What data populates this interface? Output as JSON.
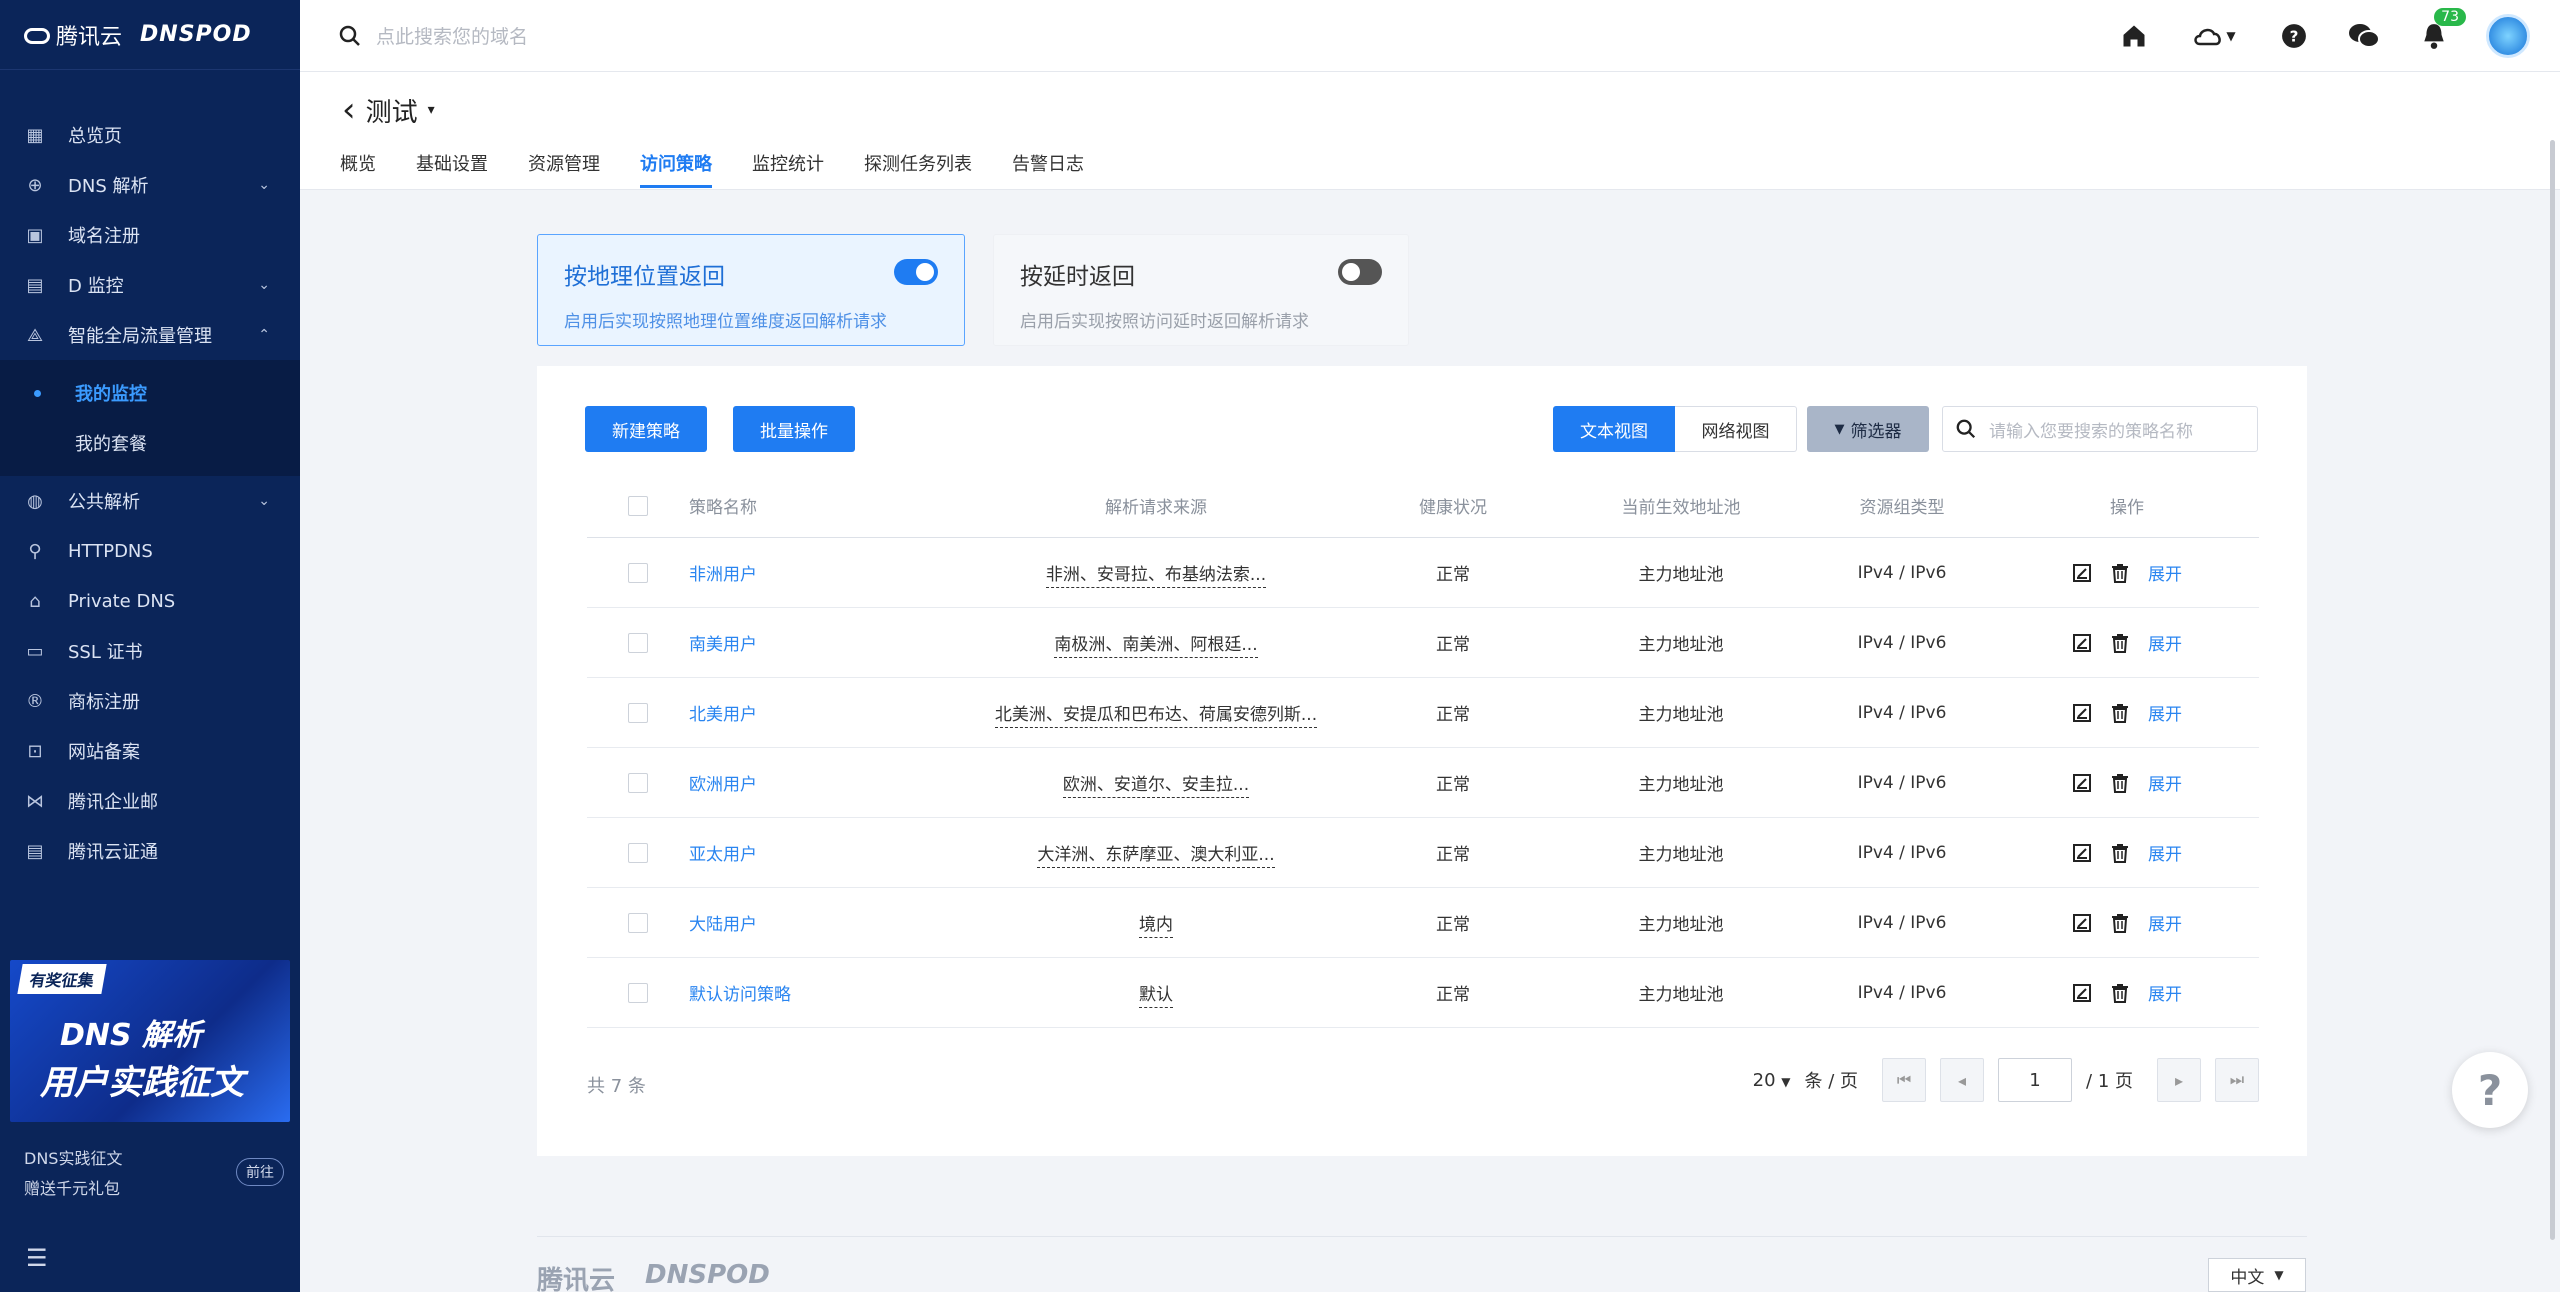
{
  "brand": {
    "name": "腾讯云",
    "product": "DNSPOD"
  },
  "sidebar": {
    "items": [
      {
        "label": "总览页",
        "icon": "grid-icon",
        "glyph": "▦"
      },
      {
        "label": "DNS 解析",
        "icon": "globe-icon",
        "glyph": "⊕",
        "chevron": "⌄"
      },
      {
        "label": "域名注册",
        "icon": "domain-icon",
        "glyph": "▣"
      },
      {
        "label": "D 监控",
        "icon": "monitor-icon",
        "glyph": "▤",
        "chevron": "⌄"
      },
      {
        "label": "智能全局流量管理",
        "icon": "traffic-icon",
        "glyph": "⟁",
        "chevron": "⌃"
      }
    ],
    "sub_items": [
      {
        "label": "我的监控",
        "active": true
      },
      {
        "label": "我的套餐",
        "active": false
      }
    ],
    "items2": [
      {
        "label": "公共解析",
        "icon": "public-dns-icon",
        "glyph": "◍",
        "chevron": "⌄"
      },
      {
        "label": "HTTPDNS",
        "icon": "httpdns-icon",
        "glyph": "⚲"
      },
      {
        "label": "Private DNS",
        "icon": "private-dns-icon",
        "glyph": "⌂"
      },
      {
        "label": "SSL 证书",
        "icon": "ssl-icon",
        "glyph": "▭"
      },
      {
        "label": "商标注册",
        "icon": "trademark-icon",
        "glyph": "®"
      },
      {
        "label": "网站备案",
        "icon": "filing-icon",
        "glyph": "⊡"
      },
      {
        "label": "腾讯企业邮",
        "icon": "mail-icon",
        "glyph": "⋈"
      },
      {
        "label": "腾讯云证通",
        "icon": "cert-icon",
        "glyph": "▤"
      }
    ],
    "promo": {
      "tag": "有奖征集",
      "line1": "DNS 解析",
      "line2": "用户实践征文",
      "text1": "DNS实践征文",
      "text2": "赠送千元礼包",
      "button": "前往"
    },
    "collapse_glyph": "☰"
  },
  "topbar": {
    "search_placeholder": "点此搜索您的域名",
    "notifications": "73"
  },
  "header": {
    "back_glyph": "‹",
    "title": "测试",
    "title_caret": "▾",
    "tabs": [
      "概览",
      "基础设置",
      "资源管理",
      "访问策略",
      "监控统计",
      "探测任务列表",
      "告警日志"
    ],
    "active_tab": 3
  },
  "modes": [
    {
      "title": "按地理位置返回",
      "desc": "启用后实现按照地理位置维度返回解析请求",
      "enabled": true
    },
    {
      "title": "按延时返回",
      "desc": "启用后实现按照访问延时返回解析请求",
      "enabled": false
    }
  ],
  "toolbar": {
    "new_label": "新建策略",
    "batch_label": "批量操作",
    "text_view": "文本视图",
    "network_view": "网络视图",
    "filter": "筛选器",
    "search_placeholder": "请输入您要搜索的策略名称"
  },
  "table": {
    "headers": [
      "策略名称",
      "解析请求来源",
      "健康状况",
      "当前生效地址池",
      "资源组类型",
      "操作"
    ],
    "rows": [
      {
        "name": "非洲用户",
        "source": "非洲、安哥拉、布基纳法索...",
        "health": "正常",
        "pool": "主力地址池",
        "type": "IPv4 / IPv6",
        "action": "展开"
      },
      {
        "name": "南美用户",
        "source": "南极洲、南美洲、阿根廷...",
        "health": "正常",
        "pool": "主力地址池",
        "type": "IPv4 / IPv6",
        "action": "展开"
      },
      {
        "name": "北美用户",
        "source": "北美洲、安提瓜和巴布达、荷属安德列斯...",
        "health": "正常",
        "pool": "主力地址池",
        "type": "IPv4 / IPv6",
        "action": "展开"
      },
      {
        "name": "欧洲用户",
        "source": "欧洲、安道尔、安圭拉...",
        "health": "正常",
        "pool": "主力地址池",
        "type": "IPv4 / IPv6",
        "action": "展开"
      },
      {
        "name": "亚太用户",
        "source": "大洋洲、东萨摩亚、澳大利亚...",
        "health": "正常",
        "pool": "主力地址池",
        "type": "IPv4 / IPv6",
        "action": "展开"
      },
      {
        "name": "大陆用户",
        "source": "境内",
        "health": "正常",
        "pool": "主力地址池",
        "type": "IPv4 / IPv6",
        "action": "展开"
      },
      {
        "name": "默认访问策略",
        "source": "默认",
        "health": "正常",
        "pool": "主力地址池",
        "type": "IPv4 / IPv6",
        "action": "展开"
      }
    ]
  },
  "pagination": {
    "total": "共 7 条",
    "page_size": "20",
    "page_size_suffix": "条 / 页",
    "current_page": "1",
    "total_pages": "/ 1 页"
  },
  "footer": {
    "brand": "腾讯云",
    "product": "DNSPOD",
    "language": "中文"
  },
  "help_glyph": "?"
}
